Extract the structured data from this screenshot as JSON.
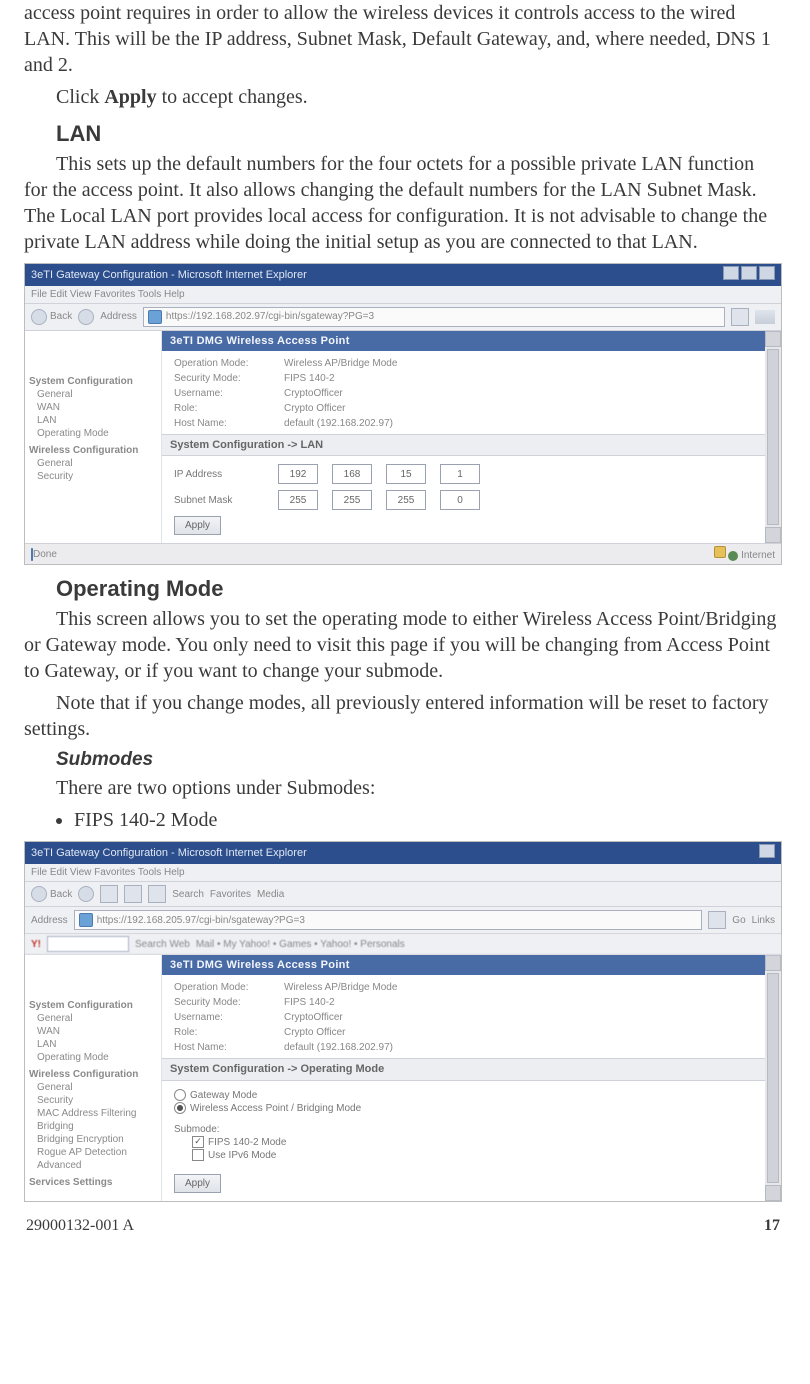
{
  "body": {
    "p1": "access point requires in order to allow the wireless devices it controls access to the wired LAN.  This will be the IP address, Subnet Mask, Default Gateway, and, where needed, DNS 1 and 2.",
    "p2a": "Click ",
    "p2b": "Apply",
    "p2c": " to accept changes.",
    "h_lan": "LAN",
    "p3": "This sets up the default numbers for the four octets for a possible private LAN function for the access point. It also allows changing the default numbers for the LAN Subnet Mask. The Local LAN port provides local access for configuration.  It is not advisable to change the private LAN address while doing the initial setup as you are connected to that LAN.",
    "h_opmode": "Operating Mode",
    "p4": "This screen allows you to set the operating mode to either Wireless Access Point/Bridging  or Gateway mode. You only need to visit this page if you will be changing from Access Point to Gateway, or if you want to change your submode.",
    "p5": "Note that if you change modes, all previously entered information will be reset to factory settings.",
    "h_submodes": "Submodes",
    "p6": "There are two options under Submodes:",
    "li1": "FIPS 140-2 Mode"
  },
  "shot_lan": {
    "title": "3eTI Gateway Configuration - Microsoft Internet Explorer",
    "menu": "File    Edit    View    Favorites    Tools    Help",
    "back": "Back",
    "addr_label": "Address",
    "addr_value": "https://192.168.202.97/cgi-bin/sgateway?PG=3",
    "header": "3eTI DMG Wireless Access Point",
    "info": {
      "k1": "Operation Mode:",
      "v1": "Wireless AP/Bridge Mode",
      "k2": "Security Mode:",
      "v2": "FIPS 140-2",
      "k3": "Username:",
      "v3": "CryptoOfficer",
      "k4": "Role:",
      "v4": "Crypto Officer",
      "k5": "Host Name:",
      "v5": "default (192.168.202.97)"
    },
    "sidebar": {
      "h1": "System Configuration",
      "i1": "General",
      "i2": "WAN",
      "i3": "LAN",
      "i4": "Operating Mode",
      "h2": "Wireless Configuration",
      "i5": "General",
      "i6": "Security"
    },
    "panel_title": "System Configuration -> LAN",
    "lbl_ip": "IP Address",
    "lbl_mask": "Subnet Mask",
    "ip": [
      "192",
      "168",
      "15",
      "1"
    ],
    "mask": [
      "255",
      "255",
      "255",
      "0"
    ],
    "apply": "Apply",
    "status_left": "Done",
    "status_right": "Internet"
  },
  "shot_op": {
    "title": "3eTI Gateway Configuration - Microsoft Internet Explorer",
    "menu": "File    Edit    View    Favorites    Tools    Help",
    "addr_label": "Address",
    "addr_value": "https://192.168.205.97/cgi-bin/sgateway?PG=3",
    "go": "Go",
    "links": "Links",
    "y_brand": "Y!",
    "y_search_label": "Search Web",
    "y_items": "Mail  •  My Yahoo!  •  Games  •  Yahoo!  •  Personals",
    "header": "3eTI DMG Wireless Access Point",
    "info": {
      "k1": "Operation Mode:",
      "v1": "Wireless AP/Bridge Mode",
      "k2": "Security Mode:",
      "v2": "FIPS 140-2",
      "k3": "Username:",
      "v3": "CryptoOfficer",
      "k4": "Role:",
      "v4": "Crypto Officer",
      "k5": "Host Name:",
      "v5": "default (192.168.202.97)"
    },
    "sidebar": {
      "h1": "System Configuration",
      "i1": "General",
      "i2": "WAN",
      "i3": "LAN",
      "i4": "Operating Mode",
      "h2": "Wireless Configuration",
      "i5": "General",
      "i6": "Security",
      "i7": "MAC Address Filtering",
      "i8": "Bridging",
      "i9": "Bridging Encryption",
      "i10": "Rogue AP Detection",
      "i11": "Advanced",
      "h3": "Services Settings"
    },
    "panel_title": "System Configuration -> Operating Mode",
    "r1": "Gateway Mode",
    "r2": "Wireless Access Point / Bridging Mode",
    "sub_lbl": "Submode:",
    "c1": "FIPS 140-2 Mode",
    "c2": "Use IPv6 Mode",
    "apply": "Apply"
  },
  "footer": {
    "left": "29000132-001 A",
    "right": "17"
  }
}
